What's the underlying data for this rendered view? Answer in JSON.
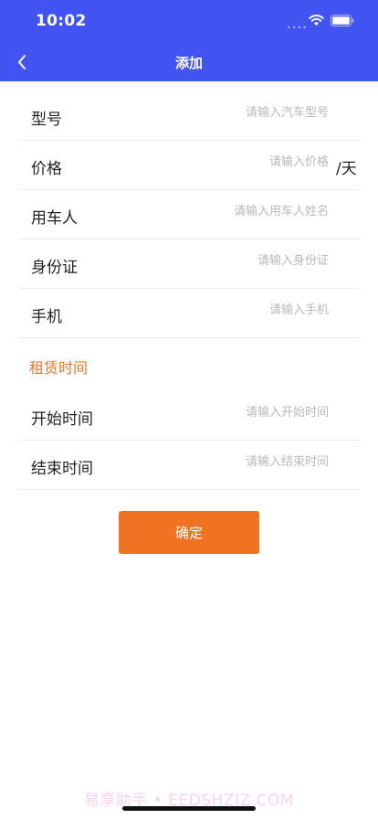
{
  "status_bar": {
    "time": "10:02",
    "signal": "••••"
  },
  "nav": {
    "title": "添加"
  },
  "form": {
    "rows": [
      {
        "label": "型号",
        "placeholder": "请输入汽车型号",
        "value": ""
      },
      {
        "label": "价格",
        "placeholder": "请输入价格",
        "value": "",
        "unit": "/天"
      },
      {
        "label": "用车人",
        "placeholder": "请输入用车人姓名",
        "value": ""
      },
      {
        "label": "身份证",
        "placeholder": "请输入身份证",
        "value": ""
      },
      {
        "label": "手机",
        "placeholder": "请输入手机",
        "value": ""
      }
    ],
    "section_title": "租赁时间",
    "time_rows": [
      {
        "label": "开始时间",
        "placeholder": "请输入开始时间",
        "value": ""
      },
      {
        "label": "结束时间",
        "placeholder": "请输入结束时间",
        "value": ""
      }
    ]
  },
  "confirm_label": "确定",
  "watermark": "易享助手 • EEDSHZIZ.COM",
  "colors": {
    "header": "#4154f1",
    "accent": "#f07322"
  }
}
